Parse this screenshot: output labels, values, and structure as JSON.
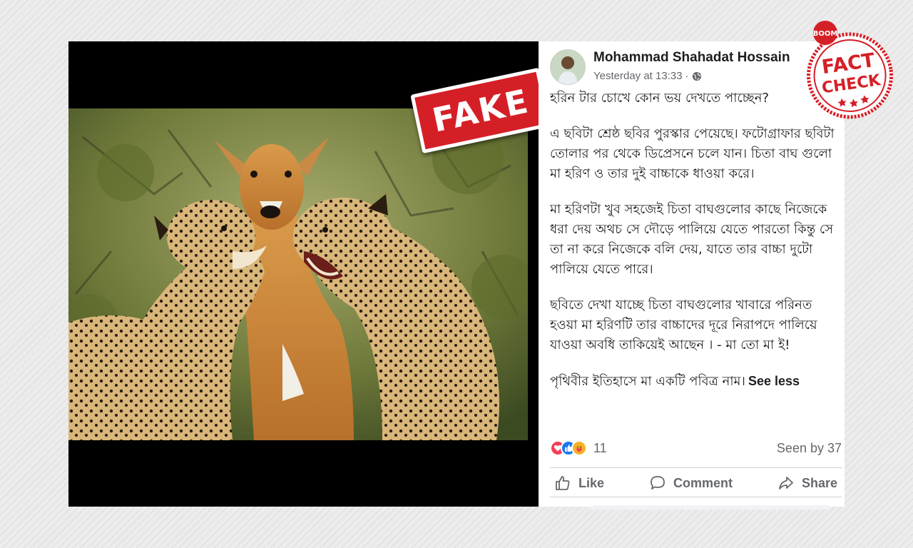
{
  "post": {
    "author": "Mohammad Shahadat Hossain",
    "timestamp": "Yesterday at 13:33",
    "separator": "·",
    "privacy_icon": "globe-icon",
    "paragraphs": [
      "হরিন টার চোখে কোন ভয় দেখতে পাচ্ছেন?",
      "এ ছবিটা শ্রেষ্ঠ ছবির পুরস্কার পেয়েছে। ফটোগ্রাফার ছবিটা তোলার পর থেকে ডিপ্রেসনে চলে যান। চিতা বাঘ গুলো মা হরিণ ও তার দুই বাচ্চাকে ধাওয়া করে।",
      "মা হরিণটা খুব সহজেই চিতা বাঘগুলোর কাছে নিজেকে ধরা দেয় অথচ সে দৌড়ে পালিয়ে যেতে পারতো কিন্তু সে তা না করে নিজেকে বলি দেয়, যাতে তার বাচ্চা দুটো পালিয়ে যেতে পারে।",
      "ছবিতে দেখা যাচ্ছে চিতা বাঘগুলোর খাবারে পরিনত হওয়া মা হরিণটি তার বাচ্চাদের দূরে নিরাপদে পালিয়ে যাওয়া অবধি তাকিয়েই আছেন । - মা তো মা ই!",
      "পৃথিবীর ইতিহাসে মা একটি পবিত্র নাম।"
    ],
    "see_less": "See less",
    "reactions": {
      "icons": [
        "love-reaction-icon",
        "like-reaction-icon",
        "care-reaction-icon"
      ],
      "count": "11"
    },
    "seen_by": "Seen by 37",
    "actions": {
      "like": "Like",
      "comment": "Comment",
      "share": "Share"
    }
  },
  "overlays": {
    "fake_stamp": "FAKE",
    "fact_check_badge": {
      "brand": "BOOM",
      "line1": "FACT",
      "line2": "CHECK"
    }
  },
  "colors": {
    "stamp_red": "#d51f27",
    "reaction_love": "#f33e58",
    "reaction_like": "#1877f2",
    "reaction_care": "#f7b125",
    "muted_text": "#65676b"
  }
}
